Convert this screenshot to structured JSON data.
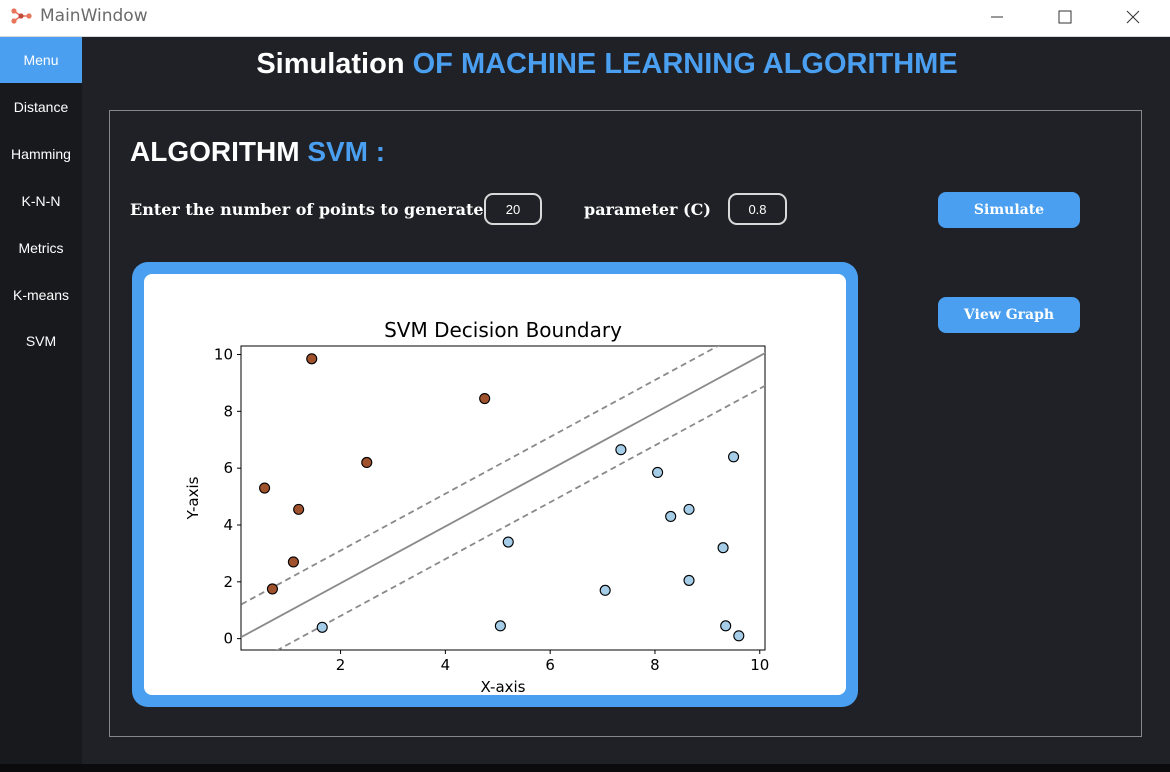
{
  "window": {
    "title": "MainWindow"
  },
  "sidebar": {
    "items": [
      {
        "label": "Menu",
        "active": true
      },
      {
        "label": "Distance"
      },
      {
        "label": "Hamming"
      },
      {
        "label": "K-N-N"
      },
      {
        "label": "Metrics"
      },
      {
        "label": "K-means"
      },
      {
        "label": "SVM"
      }
    ]
  },
  "header": {
    "title_plain": "Simulation",
    "title_accent": "OF MACHINE LEARNING ALGORITHME"
  },
  "algo": {
    "title_plain": "ALGORITHM",
    "title_accent": "SVM :"
  },
  "form": {
    "points_label": "Enter the number of points to generate",
    "points_value": "20",
    "param_label": "parameter (C)",
    "param_value": "0.8"
  },
  "buttons": {
    "simulate": "Simulate",
    "view_graph": "View Graph"
  },
  "colors": {
    "accent": "#4a9ff0",
    "background": "#202126",
    "sidebar": "#18191d",
    "class_a": "#a0522d",
    "class_b": "#a6cde8"
  },
  "chart_data": {
    "type": "scatter",
    "title": "SVM Decision Boundary",
    "xlabel": "X-axis",
    "ylabel": "Y-axis",
    "xlim": [
      0.1,
      10.1
    ],
    "ylim": [
      -0.4,
      10.3
    ],
    "xticks": [
      "2",
      "4",
      "6",
      "8",
      "10"
    ],
    "yticks": [
      "0",
      "2",
      "4",
      "6",
      "8",
      "10"
    ],
    "series": [
      {
        "class": "A",
        "color": "#a0522d",
        "points": [
          [
            1.45,
            9.85
          ],
          [
            4.75,
            8.45
          ],
          [
            0.55,
            5.3
          ],
          [
            2.5,
            6.2
          ],
          [
            1.2,
            4.55
          ],
          [
            1.1,
            2.7
          ],
          [
            0.7,
            1.75
          ]
        ]
      },
      {
        "class": "B",
        "color": "#a6cde8",
        "points": [
          [
            7.35,
            6.65
          ],
          [
            8.05,
            5.85
          ],
          [
            9.5,
            6.4
          ],
          [
            8.3,
            4.3
          ],
          [
            8.65,
            4.55
          ],
          [
            5.2,
            3.4
          ],
          [
            9.3,
            3.2
          ],
          [
            7.05,
            1.7
          ],
          [
            8.65,
            2.05
          ],
          [
            1.65,
            0.4
          ],
          [
            5.05,
            0.45
          ],
          [
            9.35,
            0.45
          ],
          [
            9.6,
            0.1
          ]
        ]
      }
    ],
    "boundary": {
      "slope": 1.0,
      "intercept": -0.05,
      "margin": 1.15
    }
  }
}
